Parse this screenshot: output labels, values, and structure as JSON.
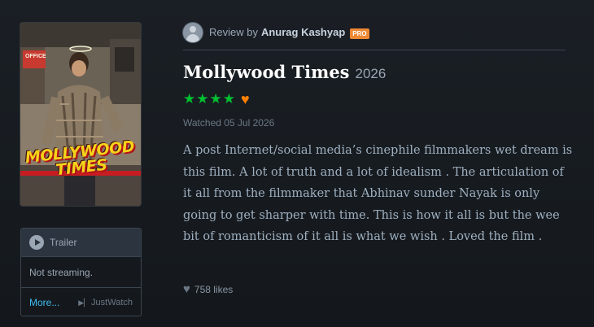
{
  "poster": {
    "title_line1": "MOLLYWOOD",
    "title_line2": "TIMES",
    "sign_text": "OFFICE"
  },
  "trailer": {
    "label": "Trailer",
    "streaming_status": "Not streaming.",
    "more_label": "More...",
    "provider": "JustWatch"
  },
  "review": {
    "review_by": "Review by",
    "author": "Anurag Kashyap",
    "badge": "PRO",
    "film_title": "Mollywood Times",
    "year": "2026",
    "rating_stars": 4,
    "liked": true,
    "watched": "Watched 05 Jul 2026",
    "body": "A post Internet/social media’s cinephile filmmakers wet dream is this film. A lot of truth and a lot of idealism . The articulation of it all from the filmmaker that Abhinav sunder Nayak is only going to get sharper with time. This is how it all is but the wee bit of romanticism of it all is what we wish . Loved the film .",
    "likes": "758 likes"
  },
  "colors": {
    "background": "#14181c",
    "star": "#00c030",
    "liked_heart": "#ff8000",
    "link": "#40bcf4",
    "pro_badge": "#ef8833"
  },
  "icons": {
    "star": "star-icon",
    "liked": "heart-icon",
    "play": "play-icon",
    "likes": "heart-icon",
    "avatar": "user-avatar"
  }
}
